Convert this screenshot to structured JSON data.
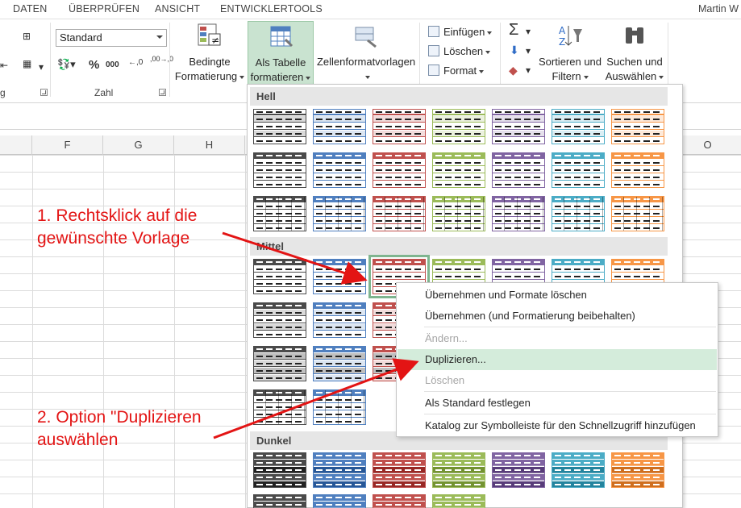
{
  "ribbon_tabs": [
    "DATEN",
    "ÜBERPRÜFEN",
    "ANSICHT",
    "ENTWICKLERTOOLS"
  ],
  "user_name": "Martin W",
  "number_format": {
    "value": "Standard",
    "percent_symbol": "%",
    "thousands_symbol": "000",
    "decimal_increase": "←,0",
    "decimal_decrease": ",00→,0"
  },
  "groups": {
    "number_label": "Zahl",
    "clip_label": "g"
  },
  "buttons": {
    "conditional": [
      "Bedingte",
      "Formatierung"
    ],
    "as_table": [
      "Als Tabelle",
      "formatieren"
    ],
    "cell_styles": [
      "Zellenformatvorlagen"
    ],
    "insert": "Einfügen",
    "delete": "Löschen",
    "format": "Format",
    "sort": [
      "Sortieren und",
      "Filtern"
    ],
    "find": [
      "Suchen und",
      "Auswählen"
    ]
  },
  "columns": [
    "F",
    "G",
    "H",
    "O"
  ],
  "gallery": {
    "sections": [
      "Hell",
      "Mittel",
      "Dunkel"
    ],
    "palette": [
      "#4a4a4a",
      "#4f7fbf",
      "#c0504d",
      "#9bbb59",
      "#8064a2",
      "#4bacc6",
      "#f79646"
    ],
    "light_palette": [
      "#d9d9d9",
      "#dce6f2",
      "#f2dcdb",
      "#ebf1de",
      "#e5e0ec",
      "#dbeef4",
      "#fde9d9"
    ]
  },
  "context_menu": {
    "items": [
      {
        "label": "Übernehmen und Formate löschen",
        "state": "normal"
      },
      {
        "label": "Übernehmen (und Formatierung beibehalten)",
        "state": "normal"
      },
      {
        "label": "Ändern...",
        "state": "disabled"
      },
      {
        "label": "Duplizieren...",
        "state": "highlighted"
      },
      {
        "label": "Löschen",
        "state": "disabled"
      },
      {
        "label": "Als Standard festlegen",
        "state": "normal"
      },
      {
        "label": "Katalog zur Symbolleiste für den Schnellzugriff hinzufügen",
        "state": "normal"
      }
    ]
  },
  "annotations": {
    "step1": [
      "1. Rechtsklick auf die",
      "gewünschte Vorlage"
    ],
    "step2": [
      "2. Option \"Duplizieren",
      "auswählen"
    ],
    "color": "#e31414"
  },
  "colors": {
    "accent_green": "#c9e3d0",
    "highlight": "#d4ecdb"
  }
}
